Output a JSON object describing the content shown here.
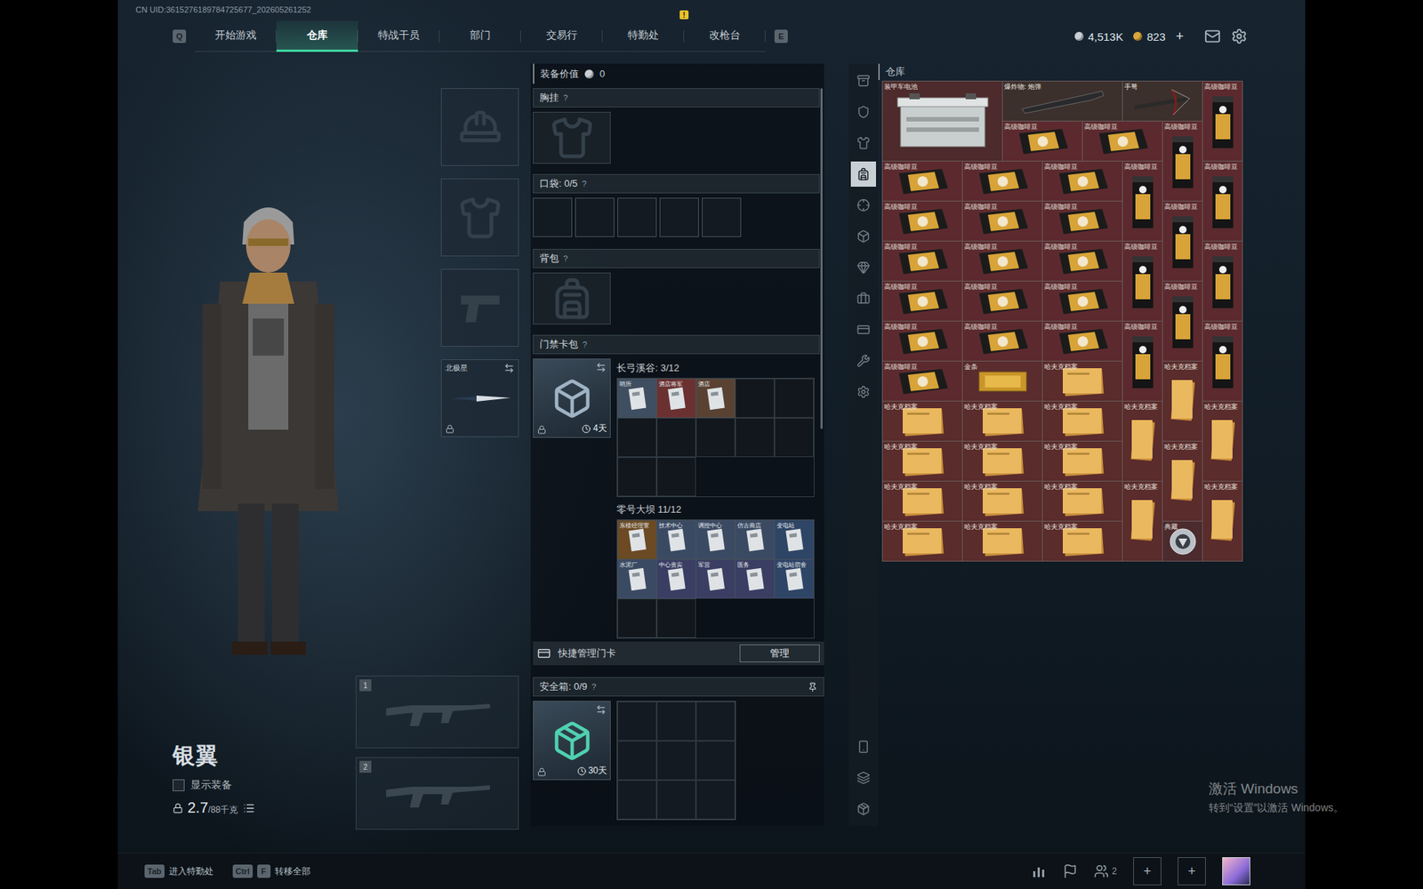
{
  "top_bar": {
    "uid": "CN UID:3615276189784725677_202605261252",
    "left_key": "Q",
    "right_key": "E",
    "tabs": [
      {
        "label": "开始游戏",
        "selected": false,
        "badge": ""
      },
      {
        "label": "仓库",
        "selected": true,
        "badge": ""
      },
      {
        "label": "特战干员",
        "selected": false,
        "badge": ""
      },
      {
        "label": "部门",
        "selected": false,
        "badge": ""
      },
      {
        "label": "交易行",
        "selected": false,
        "badge": ""
      },
      {
        "label": "特勤处",
        "selected": false,
        "badge": "!"
      },
      {
        "label": "改枪台",
        "selected": false,
        "badge": ""
      }
    ],
    "currency": [
      {
        "amount": "4,513K",
        "color": "#c9ced4"
      },
      {
        "amount": "823",
        "color": "#d9a73a"
      }
    ],
    "add": "+"
  },
  "character": {
    "name": "银翼",
    "show_gear": {
      "label": "显示装备",
      "checked": false
    },
    "weight": "2.7",
    "capacity": "/88千克"
  },
  "equipment_slots": [
    {
      "kind": "helmet",
      "label": "",
      "locked": false
    },
    {
      "kind": "armor",
      "label": "",
      "locked": false
    },
    {
      "kind": "pistol",
      "label": "",
      "locked": false
    },
    {
      "kind": "melee",
      "label": "北极星",
      "locked": true
    }
  ],
  "weapon_slots": [
    {
      "number": "1"
    },
    {
      "number": "2"
    }
  ],
  "loadout": {
    "value_label": "装备价值",
    "value": "0",
    "chest": {
      "title": "胸挂",
      "help": "?"
    },
    "pockets": {
      "title": "口袋: 0/5",
      "help": "?",
      "slot_count": 5
    },
    "backpack": {
      "title": "背包",
      "help": "?"
    },
    "keycards": {
      "title": "门禁卡包",
      "help": "?",
      "timer": "4天",
      "locked": true,
      "maps": [
        {
          "name": "长弓溪谷: 3/12",
          "slot_count": 12,
          "cards": [
            {
              "label": "哨所",
              "color": "#3f4e60"
            },
            {
              "label": "酒店将军",
              "color": "#6a3130"
            },
            {
              "label": "酒店",
              "color": "#5a4232"
            }
          ]
        },
        {
          "name": "零号大坝 11/12",
          "slot_count": 12,
          "cards": [
            {
              "label": "东楼经理室",
              "color": "#6b4a24"
            },
            {
              "label": "技术中心",
              "color": "#3b4a63"
            },
            {
              "label": "调控中心",
              "color": "#3b4a63"
            },
            {
              "label": "仿古商店",
              "color": "#3b4a63"
            },
            {
              "label": "变电站",
              "color": "#2f4566"
            },
            {
              "label": "水泥厂",
              "color": "#3b4a63"
            },
            {
              "label": "中心贵宾",
              "color": "#3a3e63"
            },
            {
              "label": "军营",
              "color": "#3a3e63"
            },
            {
              "label": "医务",
              "color": "#3a3e63"
            },
            {
              "label": "变电站宿舍",
              "color": "#2f4566"
            }
          ]
        }
      ],
      "manage_label": "快捷管理门卡",
      "manage_button": "管理"
    },
    "safe": {
      "title": "安全箱: 0/9",
      "help": "?",
      "timer": "30天",
      "locked": true,
      "pinned": true,
      "slot_count": 9
    }
  },
  "warehouse": {
    "title": "仓库",
    "tabs": [
      {
        "selected": false
      },
      {
        "selected": false
      },
      {
        "selected": false
      },
      {
        "selected": true
      },
      {
        "selected": false
      },
      {
        "selected": false
      },
      {
        "selected": false
      },
      {
        "selected": false
      },
      {
        "selected": false
      },
      {
        "selected": false
      },
      {
        "selected": false
      }
    ],
    "tools": [
      {
        "selected": false
      },
      {
        "selected": false
      },
      {
        "selected": false
      }
    ],
    "items": [
      {
        "kind": "battery",
        "label": "装甲车电池",
        "color": "#4d2a2b"
      },
      {
        "kind": "shell",
        "label": "爆炸物: 炮弹",
        "color": "#3c302c"
      },
      {
        "kind": "crossbow",
        "label": "手弩",
        "color": "#3c302c"
      },
      {
        "kind": "coffee-v",
        "label": "高级咖啡豆",
        "color": "#5c2a2e"
      },
      {
        "kind": "coffee-h",
        "label": "高级咖啡豆",
        "color": "#5c2a2e"
      },
      {
        "kind": "coffee-h",
        "label": "高级咖啡豆",
        "color": "#5c2a2e"
      },
      {
        "kind": "coffee-v",
        "label": "高级咖啡豆",
        "color": "#5c2a2e"
      },
      {
        "kind": "coffee-h",
        "label": "高级咖啡豆",
        "color": "#5c2a2e"
      },
      {
        "kind": "coffee-h",
        "label": "高级咖啡豆",
        "color": "#5c2a2e"
      },
      {
        "kind": "coffee-h",
        "label": "高级咖啡豆",
        "color": "#5c2a2e"
      },
      {
        "kind": "coffee-v",
        "label": "高级咖啡豆",
        "color": "#5c2a2e"
      },
      {
        "kind": "coffee-v",
        "label": "高级咖啡豆",
        "color": "#5c2a2e"
      },
      {
        "kind": "coffee-h",
        "label": "高级咖啡豆",
        "color": "#5c2a2e"
      },
      {
        "kind": "coffee-h",
        "label": "高级咖啡豆",
        "color": "#5c2a2e"
      },
      {
        "kind": "coffee-h",
        "label": "高级咖啡豆",
        "color": "#5c2a2e"
      },
      {
        "kind": "coffee-v",
        "label": "高级咖啡豆",
        "color": "#5c2a2e"
      },
      {
        "kind": "coffee-h",
        "label": "高级咖啡豆",
        "color": "#5c2a2e"
      },
      {
        "kind": "coffee-h",
        "label": "高级咖啡豆",
        "color": "#5c2a2e"
      },
      {
        "kind": "coffee-h",
        "label": "高级咖啡豆",
        "color": "#5c2a2e"
      },
      {
        "kind": "coffee-v",
        "label": "高级咖啡豆",
        "color": "#5c2a2e"
      },
      {
        "kind": "coffee-v",
        "label": "高级咖啡豆",
        "color": "#5c2a2e"
      },
      {
        "kind": "coffee-h",
        "label": "高级咖啡豆",
        "color": "#5c2a2e"
      },
      {
        "kind": "coffee-h",
        "label": "高级咖啡豆",
        "color": "#5c2a2e"
      },
      {
        "kind": "coffee-h",
        "label": "高级咖啡豆",
        "color": "#5c2a2e"
      },
      {
        "kind": "coffee-v",
        "label": "高级咖啡豆",
        "color": "#5c2a2e"
      },
      {
        "kind": "coffee-h",
        "label": "高级咖啡豆",
        "color": "#5c2a2e"
      },
      {
        "kind": "coffee-h",
        "label": "高级咖啡豆",
        "color": "#5c2a2e"
      },
      {
        "kind": "coffee-h",
        "label": "高级咖啡豆",
        "color": "#5c2a2e"
      },
      {
        "kind": "coffee-v",
        "label": "高级咖啡豆",
        "color": "#5c2a2e"
      },
      {
        "kind": "coffee-v",
        "label": "高级咖啡豆",
        "color": "#5c2a2e"
      },
      {
        "kind": "coffee-h",
        "label": "高级咖啡豆",
        "color": "#5c2a2e"
      },
      {
        "kind": "gold",
        "label": "金条",
        "color": "#5a2c2e"
      },
      {
        "kind": "file-h",
        "label": "哈夫克档案",
        "color": "#5a2c2c"
      },
      {
        "kind": "file-v",
        "label": "哈夫克档案",
        "color": "#5a2c2c"
      },
      {
        "kind": "file-h",
        "label": "哈夫克档案",
        "color": "#5a2c2c"
      },
      {
        "kind": "file-h",
        "label": "哈夫克档案",
        "color": "#5a2c2c"
      },
      {
        "kind": "file-h",
        "label": "哈夫克档案",
        "color": "#5a2c2c"
      },
      {
        "kind": "file-v",
        "label": "哈夫克档案",
        "color": "#5a2c2c"
      },
      {
        "kind": "file-v",
        "label": "哈夫克档案",
        "color": "#5a2c2c"
      },
      {
        "kind": "file-h",
        "label": "哈夫克档案",
        "color": "#5a2c2c"
      },
      {
        "kind": "file-h",
        "label": "哈夫克档案",
        "color": "#5a2c2c"
      },
      {
        "kind": "file-h",
        "label": "哈夫克档案",
        "color": "#5a2c2c"
      },
      {
        "kind": "file-v",
        "label": "哈夫克档案",
        "color": "#5a2c2c"
      },
      {
        "kind": "file-h",
        "label": "哈夫克档案",
        "color": "#5a2c2c"
      },
      {
        "kind": "file-h",
        "label": "哈夫克档案",
        "color": "#5a2c2c"
      },
      {
        "kind": "file-h",
        "label": "哈夫克档案",
        "color": "#5a2c2c"
      },
      {
        "kind": "file-v",
        "label": "哈夫克档案",
        "color": "#5a2c2c"
      },
      {
        "kind": "file-v",
        "label": "哈夫克档案",
        "color": "#5a2c2c"
      },
      {
        "kind": "file-h",
        "label": "哈夫克档案",
        "color": "#5a2c2c"
      },
      {
        "kind": "file-h",
        "label": "哈夫克档案",
        "color": "#5a2c2c"
      },
      {
        "kind": "file-h",
        "label": "哈夫克档案",
        "color": "#5a2c2c"
      },
      {
        "kind": "badge",
        "label": "典藏",
        "color": "#4b2b2e"
      }
    ]
  },
  "bottom_bar": {
    "hints": [
      {
        "keys": [
          "Tab"
        ],
        "label": "进入特勤处"
      },
      {
        "keys": [
          "Ctrl",
          "F"
        ],
        "label": "转移全部"
      }
    ],
    "friends_count": "2",
    "party_slots": [
      {
        "label": "+"
      },
      {
        "label": "+"
      }
    ]
  },
  "watermark": {
    "title": "激活 Windows",
    "subtitle": "转到“设置”以激活 Windows。"
  }
}
